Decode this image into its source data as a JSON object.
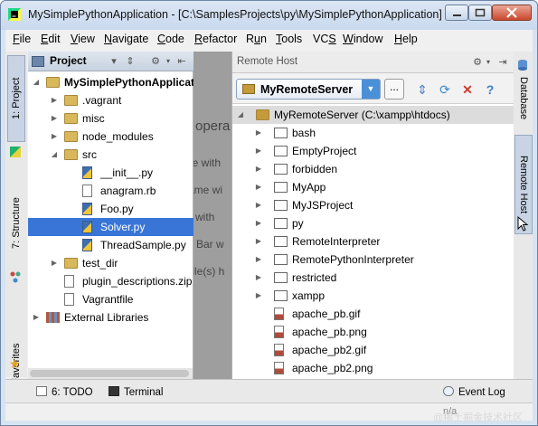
{
  "window": {
    "title": "MySimplePythonApplication - [C:\\SamplesProjects\\py\\MySimplePythonApplication] - ...",
    "controls": {
      "minimize": "—",
      "maximize": "□",
      "close": "✕"
    }
  },
  "menubar": {
    "items": [
      {
        "label": "File",
        "mnemonic": "F"
      },
      {
        "label": "Edit",
        "mnemonic": "E"
      },
      {
        "label": "View",
        "mnemonic": "V"
      },
      {
        "label": "Navigate",
        "mnemonic": "N"
      },
      {
        "label": "Code",
        "mnemonic": "C"
      },
      {
        "label": "Refactor",
        "mnemonic": "R"
      },
      {
        "label": "Run",
        "mnemonic": "u"
      },
      {
        "label": "Tools",
        "mnemonic": "T"
      },
      {
        "label": "VCS",
        "mnemonic": "S"
      },
      {
        "label": "Window",
        "mnemonic": "W"
      },
      {
        "label": "Help",
        "mnemonic": "H"
      }
    ]
  },
  "left_tool_strip": {
    "project_tab": "1: Project",
    "structure_tab": "7: Structure",
    "favorites_tab": "2: Favorites"
  },
  "right_tool_strip": {
    "database_tab": "Database",
    "remote_host_tab": "Remote Host"
  },
  "project_panel": {
    "title": "Project",
    "tree": [
      {
        "label": "MySimplePythonApplicati",
        "type": "folder",
        "depth": 0,
        "expanded": true,
        "bold": true
      },
      {
        "label": ".vagrant",
        "type": "folder",
        "depth": 1,
        "expanded": false
      },
      {
        "label": "misc",
        "type": "folder",
        "depth": 1,
        "expanded": false
      },
      {
        "label": "node_modules",
        "type": "folder",
        "depth": 1,
        "expanded": false
      },
      {
        "label": "src",
        "type": "folder",
        "depth": 1,
        "expanded": true
      },
      {
        "label": "__init__.py",
        "type": "py",
        "depth": 2
      },
      {
        "label": "anagram.rb",
        "type": "file",
        "depth": 2
      },
      {
        "label": "Foo.py",
        "type": "py",
        "depth": 2
      },
      {
        "label": "Solver.py",
        "type": "py",
        "depth": 2,
        "selected": true
      },
      {
        "label": "ThreadSample.py",
        "type": "py",
        "depth": 2
      },
      {
        "label": "test_dir",
        "type": "folder",
        "depth": 1,
        "expanded": false
      },
      {
        "label": "plugin_descriptions.zip",
        "type": "file",
        "depth": 1
      },
      {
        "label": "Vagrantfile",
        "type": "file",
        "depth": 1
      },
      {
        "label": "External Libraries",
        "type": "lib",
        "depth": 0,
        "expanded": false
      }
    ]
  },
  "editor_background": {
    "lines": [
      "opera",
      "ere with",
      "ame wi",
      "es with",
      "n Bar w",
      "file(s) h"
    ]
  },
  "remote_panel": {
    "title": "Remote Host",
    "server_selected": "MyRemoteServer",
    "browse_label": "...",
    "tree": [
      {
        "label": "MyRemoteServer (C:\\xampp\\htdocs)",
        "type": "server",
        "root": true
      },
      {
        "label": "bash",
        "type": "folder"
      },
      {
        "label": "EmptyProject",
        "type": "folder"
      },
      {
        "label": "forbidden",
        "type": "folder"
      },
      {
        "label": "MyApp",
        "type": "folder"
      },
      {
        "label": "MyJSProject",
        "type": "folder"
      },
      {
        "label": "py",
        "type": "folder"
      },
      {
        "label": "RemoteInterpreter",
        "type": "folder"
      },
      {
        "label": "RemotePythonInterpreter",
        "type": "folder"
      },
      {
        "label": "restricted",
        "type": "folder"
      },
      {
        "label": "xampp",
        "type": "folder"
      },
      {
        "label": "apache_pb.gif",
        "type": "file"
      },
      {
        "label": "apache_pb.png",
        "type": "file"
      },
      {
        "label": "apache_pb2.gif",
        "type": "file"
      },
      {
        "label": "apache_pb2.png",
        "type": "file"
      }
    ]
  },
  "bottom_bar": {
    "todo": "6: TODO",
    "terminal": "Terminal",
    "event_log": "Event Log"
  },
  "status_bar": {
    "na": "n/a"
  },
  "watermark": "@稀土掘金技术社区"
}
